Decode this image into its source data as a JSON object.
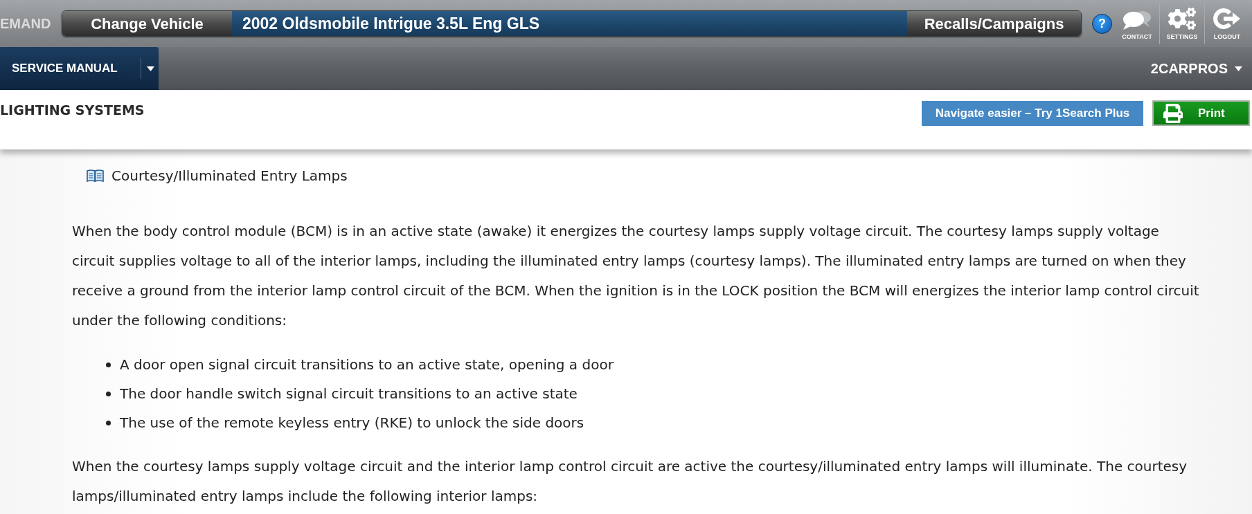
{
  "top_bar": {
    "brand_fragment": "EMAND",
    "change_vehicle": "Change Vehicle",
    "vehicle": "2002 Oldsmobile Intrigue 3.5L Eng GLS",
    "recalls": "Recalls/Campaigns",
    "help": "?",
    "tools": [
      {
        "kind": "contact",
        "label": "CONTACT"
      },
      {
        "kind": "settings",
        "label": "SETTINGS"
      },
      {
        "kind": "logout",
        "label": "LOGOUT"
      }
    ]
  },
  "nav_bar": {
    "manual": "SERVICE MANUAL",
    "account": "2CARPROS"
  },
  "page_header": {
    "title": "LIGHTING SYSTEMS",
    "buttons": [
      {
        "kind": "promo",
        "label": "Navigate easier – Try 1Search Plus"
      },
      {
        "kind": "print",
        "label": "Print"
      }
    ]
  },
  "article": {
    "title": "Courtesy/Illuminated Entry Lamps",
    "blocks": [
      {
        "kind": "paragraph",
        "text": "When the body control module (BCM) is in an active state (awake) it energizes the courtesy lamps supply voltage circuit. The courtesy lamps supply voltage circuit supplies voltage to all of the interior lamps, including the illuminated entry lamps (courtesy lamps). The illuminated entry lamps are turned on when they receive a ground from the interior lamp control circuit of the BCM. When the ignition is in the LOCK position the BCM will energizes the interior lamp control circuit under the following conditions:"
      },
      {
        "kind": "bullets",
        "items": [
          "A door open signal circuit transitions to an active state, opening a door",
          "The door handle switch signal circuit transitions to an active state",
          "The use of the remote keyless entry (RKE) to unlock the side doors"
        ]
      },
      {
        "kind": "paragraph",
        "text": "When the courtesy lamps supply voltage circuit and the interior lamp control circuit are active the courtesy/illuminated entry lamps will illuminate. The courtesy lamps/illuminated entry lamps include the following interior lamps:"
      }
    ]
  }
}
